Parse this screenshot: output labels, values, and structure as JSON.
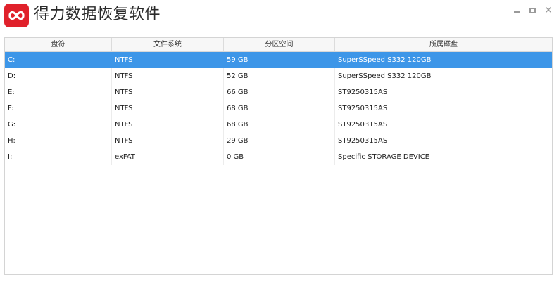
{
  "app": {
    "title": "得力数据恢复软件",
    "logo_icon": "infinity-logo-icon",
    "accent_color": "#e0212b"
  },
  "window_controls": {
    "minimize_icon": "minimize-icon",
    "maximize_icon": "maximize-icon",
    "close_icon": "close-icon",
    "close_glyph": "✕"
  },
  "table": {
    "headers": [
      "盘符",
      "文件系统",
      "分区空间",
      "所属磁盘"
    ],
    "selected_color": "#3d96e8",
    "rows": [
      {
        "drive": "C:",
        "fs": "NTFS",
        "size": "59 GB",
        "disk": "SuperSSpeed S332 120GB",
        "selected": true
      },
      {
        "drive": "D:",
        "fs": "NTFS",
        "size": "52 GB",
        "disk": "SuperSSpeed S332 120GB",
        "selected": false
      },
      {
        "drive": "E:",
        "fs": "NTFS",
        "size": "66 GB",
        "disk": "ST9250315AS",
        "selected": false
      },
      {
        "drive": "F:",
        "fs": "NTFS",
        "size": "68 GB",
        "disk": "ST9250315AS",
        "selected": false
      },
      {
        "drive": "G:",
        "fs": "NTFS",
        "size": "68 GB",
        "disk": "ST9250315AS",
        "selected": false
      },
      {
        "drive": "H:",
        "fs": "NTFS",
        "size": "29 GB",
        "disk": "ST9250315AS",
        "selected": false
      },
      {
        "drive": "I:",
        "fs": "exFAT",
        "size": "0 GB",
        "disk": "Specific STORAGE DEVICE",
        "selected": false
      }
    ]
  }
}
